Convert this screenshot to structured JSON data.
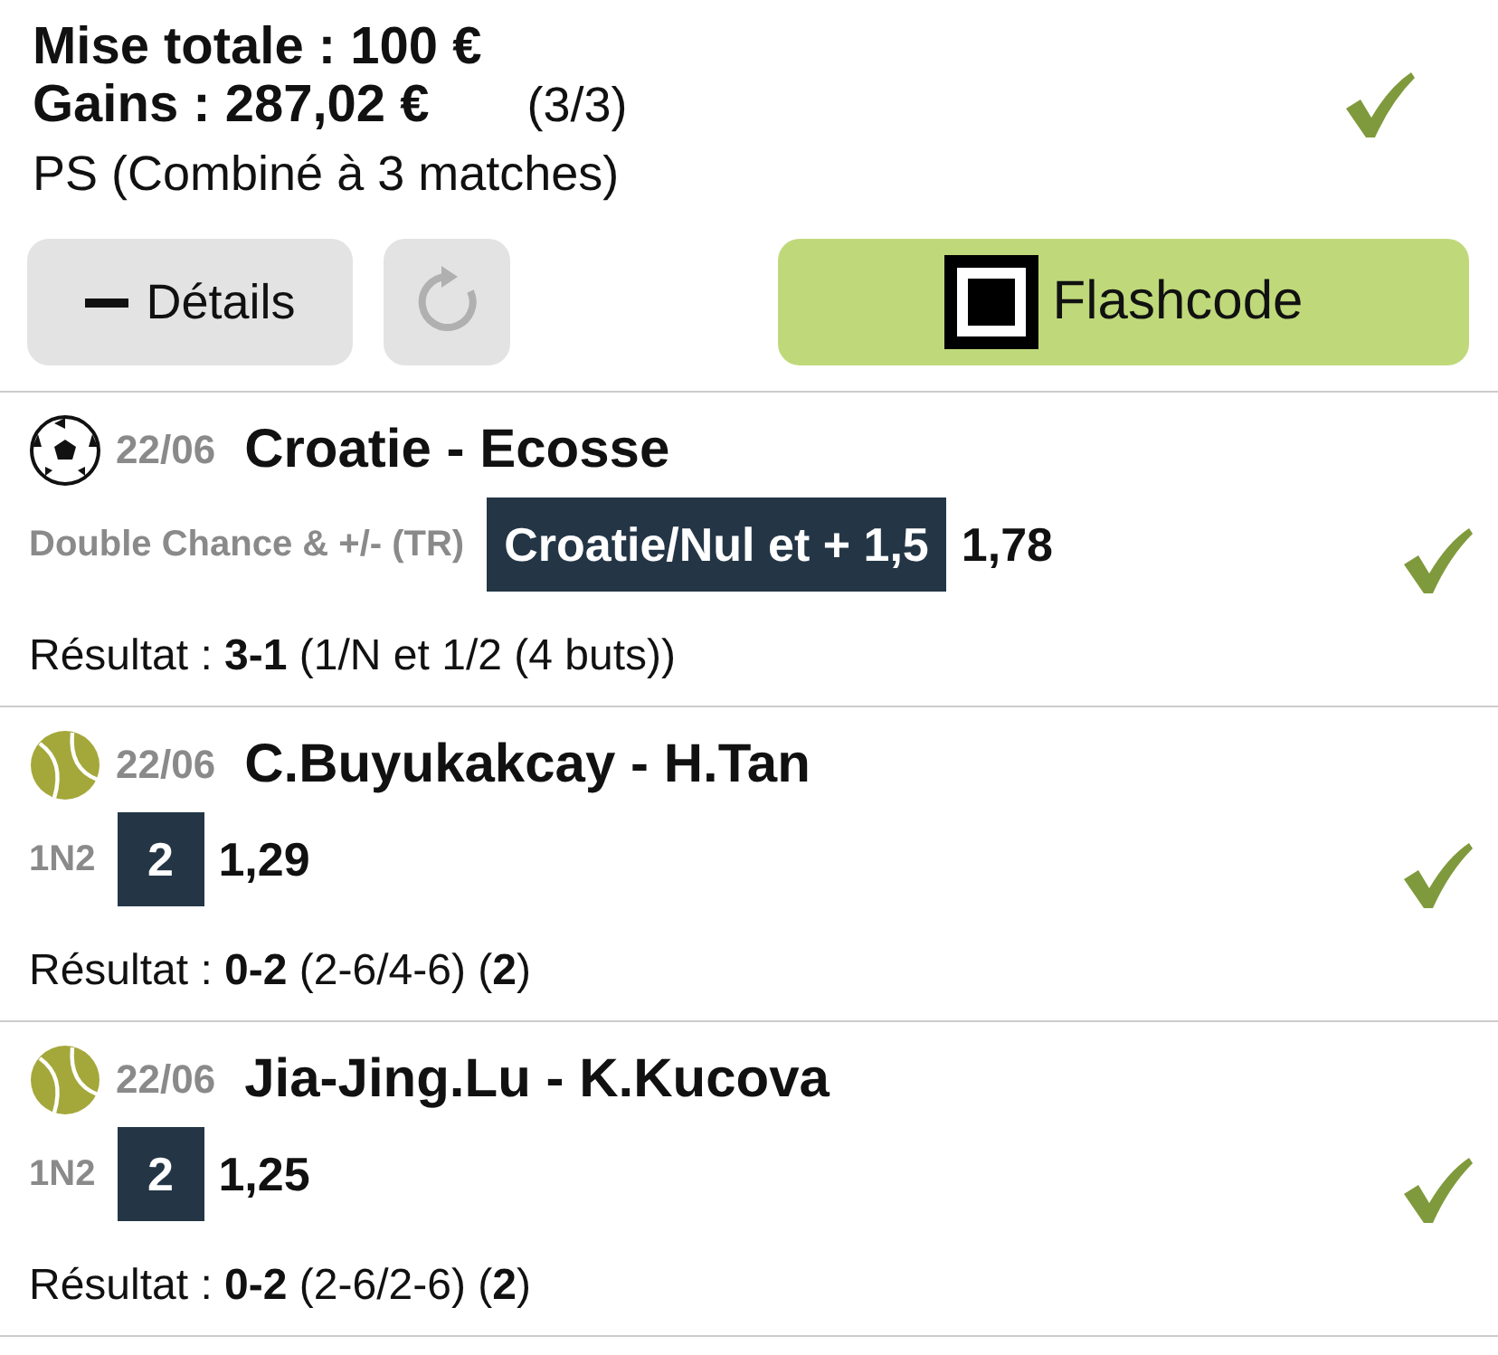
{
  "summary": {
    "stake": "Mise totale : 100 €",
    "winnings": "Gains : 287,02 €",
    "count": "(3/3)",
    "type": "PS (Combiné à 3 matches)",
    "won": true
  },
  "buttons": {
    "details": "Détails",
    "flashcode": "Flashcode"
  },
  "matches": [
    {
      "kind": "football",
      "date": "22/06",
      "teams": "Croatie - Ecosse",
      "market": "Double Chance & +/- (TR)",
      "pick": "Croatie/Nul et + 1,5",
      "odds": "1,78",
      "result": "Résultat : **3-1** (1/N et 1/2 (4 buts))",
      "won": true
    },
    {
      "kind": "tennis",
      "date": "22/06",
      "teams": "C.Buyukakcay - H.Tan",
      "market": "1N2",
      "pick": "2",
      "odds": "1,29",
      "result": "Résultat : **0-2** (2-6/4-6) (**2**)",
      "won": true
    },
    {
      "kind": "tennis",
      "date": "22/06",
      "teams": "Jia-Jing.Lu - K.Kucova",
      "market": "1N2",
      "pick": "2",
      "odds": "1,25",
      "result": "Résultat : **0-2** (2-6/2-6) (**2**)",
      "won": true
    }
  ]
}
